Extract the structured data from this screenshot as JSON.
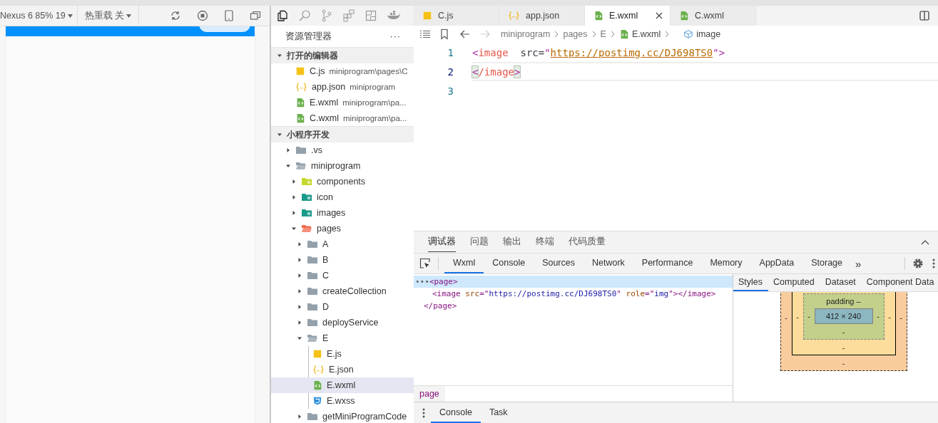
{
  "simulator": {
    "device": "Nexus 6 85% 19",
    "hot_reload": "热重载 关"
  },
  "explorer": {
    "title": "资源管理器",
    "more": "···",
    "open_editors": {
      "title": "打开的编辑器",
      "expanded": true,
      "items": [
        {
          "name": "C.js",
          "path": "miniprogram\\pages\\C",
          "kind": "js"
        },
        {
          "name": "app.json",
          "path": "miniprogram",
          "kind": "json"
        },
        {
          "name": "E.wxml",
          "path": "miniprogram\\pa...",
          "kind": "wxml"
        },
        {
          "name": "C.wxml",
          "path": "miniprogram\\pa...",
          "kind": "wxml"
        }
      ]
    },
    "project": {
      "title": "小程序开发",
      "expanded": true,
      "tree": [
        {
          "name": ".vs",
          "kind": "folder",
          "expanded": false,
          "selected": false
        },
        {
          "name": "miniprogram",
          "kind": "folder",
          "expanded": true,
          "selected": false,
          "children": [
            {
              "name": "components",
              "kind": "folder",
              "color": "#c5d82e",
              "expanded": false,
              "selected": false
            },
            {
              "name": "icon",
              "kind": "folder",
              "color": "#1a9a8a",
              "expanded": false,
              "selected": false
            },
            {
              "name": "images",
              "kind": "folder",
              "color": "#1a9a8a",
              "expanded": false,
              "selected": false
            },
            {
              "name": "pages",
              "kind": "folder",
              "color": "#f26b4f",
              "expanded": true,
              "selected": false,
              "children": [
                {
                  "name": "A",
                  "kind": "folder",
                  "expanded": false,
                  "selected": false
                },
                {
                  "name": "B",
                  "kind": "folder",
                  "expanded": false,
                  "selected": false
                },
                {
                  "name": "C",
                  "kind": "folder",
                  "expanded": false,
                  "selected": false
                },
                {
                  "name": "createCollection",
                  "kind": "folder",
                  "expanded": false,
                  "selected": false
                },
                {
                  "name": "D",
                  "kind": "folder",
                  "expanded": false,
                  "selected": false
                },
                {
                  "name": "deployService",
                  "kind": "folder",
                  "expanded": false,
                  "selected": false
                },
                {
                  "name": "E",
                  "kind": "folder",
                  "expanded": true,
                  "selected": false,
                  "children": [
                    {
                      "name": "E.js",
                      "kind": "js",
                      "selected": false
                    },
                    {
                      "name": "E.json",
                      "kind": "json",
                      "selected": false
                    },
                    {
                      "name": "E.wxml",
                      "kind": "wxml",
                      "selected": true
                    },
                    {
                      "name": "E.wxss",
                      "kind": "wxss",
                      "selected": false
                    }
                  ]
                },
                {
                  "name": "getMiniProgramCode",
                  "kind": "folder",
                  "expanded": false,
                  "selected": false
                }
              ]
            }
          ]
        }
      ]
    }
  },
  "editor": {
    "tabs": [
      {
        "label": "C.js",
        "kind": "js",
        "selected": false
      },
      {
        "label": "app.json",
        "kind": "json",
        "selected": false
      },
      {
        "label": "E.wxml",
        "kind": "wxml",
        "selected": true
      },
      {
        "label": "C.wxml",
        "kind": "wxml",
        "selected": false
      }
    ],
    "breadcrumb": [
      {
        "label": "miniprogram",
        "kind": "text"
      },
      {
        "label": "pages",
        "kind": "text"
      },
      {
        "label": "E",
        "kind": "text"
      },
      {
        "label": "E.wxml",
        "kind": "wxml"
      },
      {
        "label": "image",
        "kind": "element"
      }
    ],
    "lines": [
      {
        "number": "1",
        "current": false,
        "tokens": [
          {
            "text": "<",
            "kind": "bracket"
          },
          {
            "text": "image",
            "kind": "tag"
          },
          {
            "text": "  src=",
            "kind": "attr"
          },
          {
            "text": "\"",
            "kind": "quote"
          },
          {
            "text": "https://postimg.cc/DJ698TS0",
            "kind": "link"
          },
          {
            "text": "\"",
            "kind": "quote"
          },
          {
            "text": ">",
            "kind": "bracket"
          }
        ]
      },
      {
        "number": "2",
        "current": true,
        "tokens": [
          {
            "text": "<",
            "kind": "bracket-match"
          },
          {
            "text": "/image",
            "kind": "tag"
          },
          {
            "text": ">",
            "kind": "bracket-match"
          }
        ]
      },
      {
        "number": "3",
        "current": false
      }
    ]
  },
  "devtools": {
    "panel_tabs": [
      {
        "label": "调试器",
        "selected": true
      },
      {
        "label": "问题",
        "selected": false
      },
      {
        "label": "输出",
        "selected": false
      },
      {
        "label": "终端",
        "selected": false
      },
      {
        "label": "代码质量",
        "selected": false
      }
    ],
    "tabs": [
      {
        "label": "Wxml",
        "selected": true
      },
      {
        "label": "Console",
        "selected": false
      },
      {
        "label": "Sources",
        "selected": false
      },
      {
        "label": "Network",
        "selected": false
      },
      {
        "label": "Performance",
        "selected": false
      },
      {
        "label": "Memory",
        "selected": false
      },
      {
        "label": "AppData",
        "selected": false
      },
      {
        "label": "Storage",
        "selected": false
      }
    ],
    "overflow": "»",
    "elements": [
      {
        "prefix": "•••",
        "selected": true,
        "tokens": [
          {
            "text": "<page>",
            "kind": "tag"
          }
        ]
      },
      {
        "selected": false,
        "tokens": [
          {
            "text": "<image",
            "kind": "tag"
          },
          {
            "text": " src",
            "kind": "attr"
          },
          {
            "text": "=\"",
            "kind": "tag"
          },
          {
            "text": "https://postimg.cc/DJ698TS0",
            "kind": "value"
          },
          {
            "text": "\"",
            "kind": "tag"
          },
          {
            "text": " role",
            "kind": "attr"
          },
          {
            "text": "=\"",
            "kind": "tag"
          },
          {
            "text": "img",
            "kind": "value"
          },
          {
            "text": "\"></image>",
            "kind": "tag"
          }
        ]
      },
      {
        "selected": false,
        "tokens": [
          {
            "text": "</page>",
            "kind": "tag"
          }
        ]
      }
    ],
    "element_path": "page",
    "side_tabs": [
      {
        "label": "Styles",
        "selected": true
      },
      {
        "label": "Computed",
        "selected": false
      },
      {
        "label": "Dataset",
        "selected": false
      },
      {
        "label": "Component Data",
        "selected": false
      }
    ],
    "box_model": {
      "margin": {
        "left": "-",
        "right": "-",
        "bottom": "-"
      },
      "border": {
        "left": "-",
        "right": "-",
        "bottom": "-"
      },
      "padding": {
        "label": "padding –",
        "left": "-",
        "right": "-",
        "bottom": "-"
      },
      "content": "412 × 240"
    },
    "drawer_tabs": [
      {
        "label": "Console",
        "selected": true
      },
      {
        "label": "Task",
        "selected": false
      }
    ]
  }
}
